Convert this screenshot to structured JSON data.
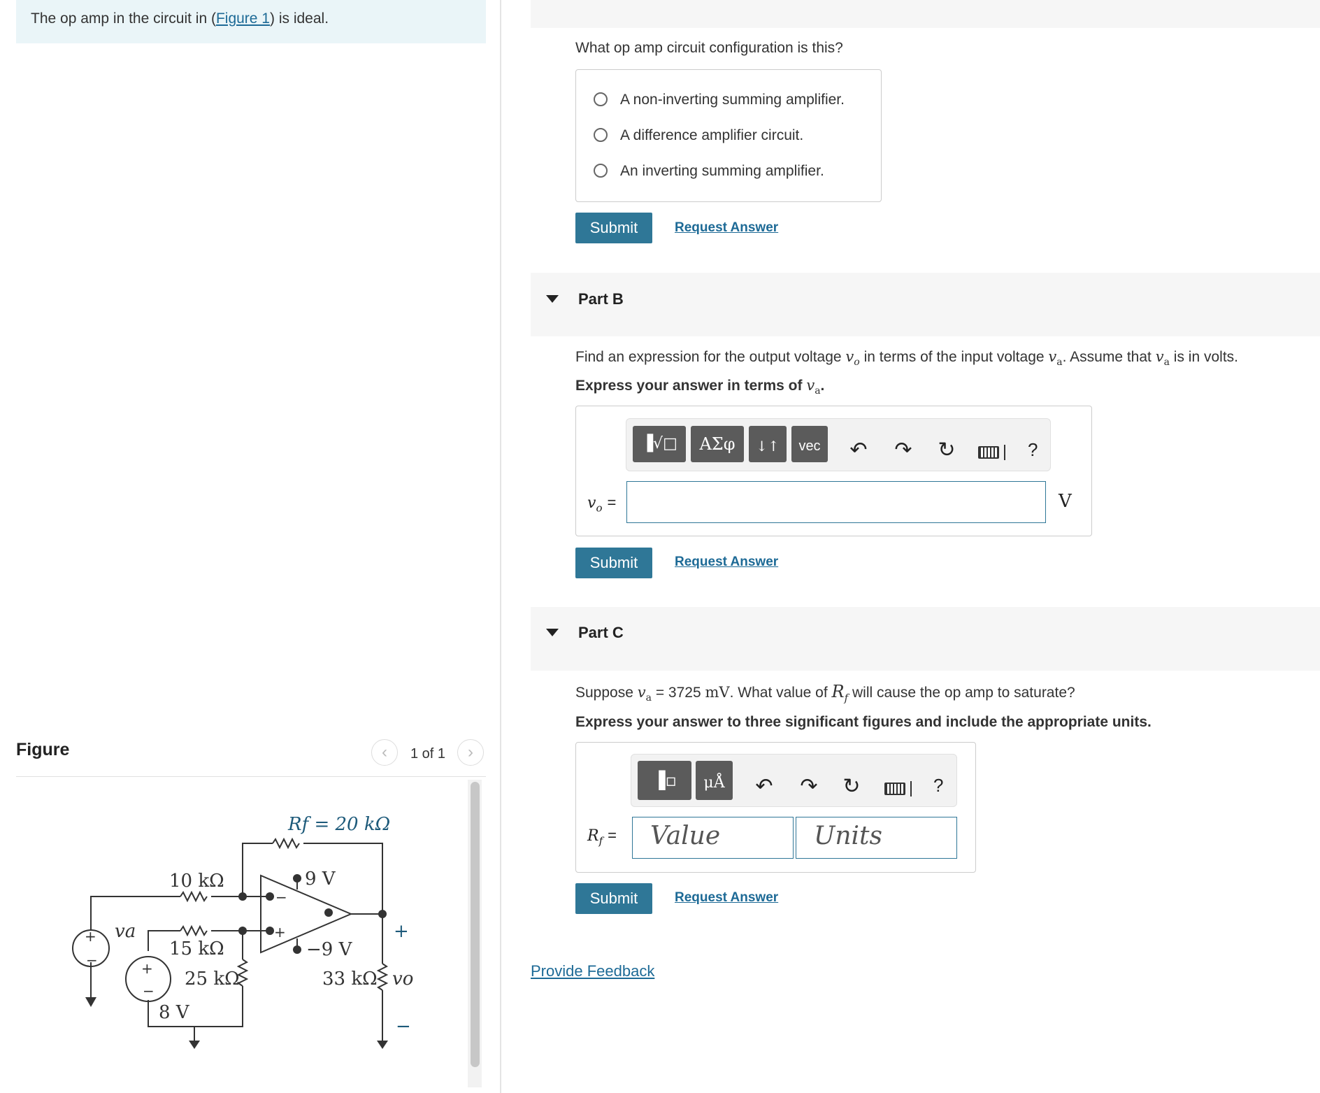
{
  "problem": {
    "intro_before": "The op amp in the circuit in (",
    "intro_link": "Figure 1",
    "intro_after": ") is ideal."
  },
  "figure": {
    "title": "Figure",
    "pager_text": "1 of 1",
    "prev_icon": "chevron-left-icon",
    "next_icon": "chevron-right-icon",
    "circuit": {
      "rf_label": "Rf = 20 kΩ",
      "r10": "10 kΩ",
      "r15": "15 kΩ",
      "r25": "25 kΩ",
      "r33": "33 kΩ",
      "va": "va",
      "vo": "vo",
      "v8": "8 V",
      "vpos": "9 V",
      "vneg": "−9 V",
      "plus": "+",
      "minus": "−"
    }
  },
  "partA": {
    "question": "What op amp circuit configuration is this?",
    "options": [
      "A non-inverting summing amplifier.",
      "A difference amplifier circuit.",
      "An inverting summing amplifier."
    ],
    "submit": "Submit",
    "request": "Request Answer"
  },
  "partB": {
    "label": "Part B",
    "q_before": "Find an expression for the output voltage",
    "q_vo": "v",
    "q_vo_sub": "o",
    "q_mid": "in terms of the input voltage",
    "q_va": "v",
    "q_va_sub": "a",
    "q_after": ". Assume that",
    "q_va2": "v",
    "q_va2_sub": "a",
    "q_end": "is in volts.",
    "instr": "Express your answer in terms of",
    "instr_var": "v",
    "instr_var_sub": "a",
    "instr_end": ".",
    "toolbar": {
      "t1": "▐√□",
      "t2": "ΑΣφ",
      "t3": "↓↑",
      "t4": "vec",
      "help": "?"
    },
    "lhs": "v",
    "lhs_sub": "o",
    "lhs_eq": "=",
    "input_value": "",
    "unit": "V",
    "submit": "Submit",
    "request": "Request Answer"
  },
  "partC": {
    "label": "Part C",
    "q_before": "Suppose",
    "q_var": "v",
    "q_var_sub": "a",
    "q_eq": "= 3725",
    "q_unit": "mV",
    "q_mid": ". What value of",
    "q_rf": "R",
    "q_rf_sub": "f",
    "q_end": "will cause the op amp to saturate?",
    "instr": "Express your answer to three significant figures and include the appropriate units.",
    "toolbar": {
      "t1": "▐▫",
      "t2": "μÅ",
      "help": "?"
    },
    "lhs": "R",
    "lhs_sub": "f",
    "lhs_eq": "=",
    "value_placeholder": "Value",
    "units_placeholder": "Units",
    "submit": "Submit",
    "request": "Request Answer"
  },
  "feedback": "Provide Feedback"
}
